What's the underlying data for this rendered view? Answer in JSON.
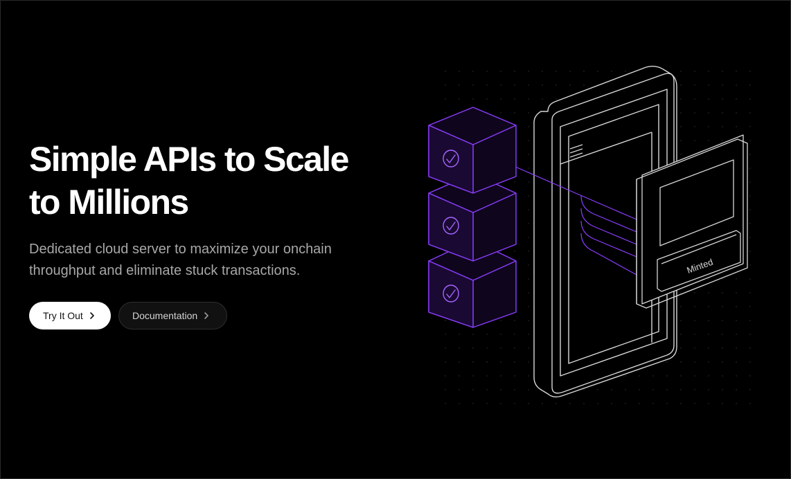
{
  "hero": {
    "headline_line1": "Simple APIs to Scale",
    "headline_line2": "to Millions",
    "subhead": "Dedicated cloud server to maximize your onchain throughput and eliminate stuck transactions."
  },
  "cta": {
    "primary_label": "Try It Out",
    "secondary_label": "Documentation"
  },
  "illustration": {
    "card_label": "Minted",
    "block_icon": "check-circle-icon",
    "accent_color": "#8b3dff",
    "line_color": "#d9d9d9"
  }
}
